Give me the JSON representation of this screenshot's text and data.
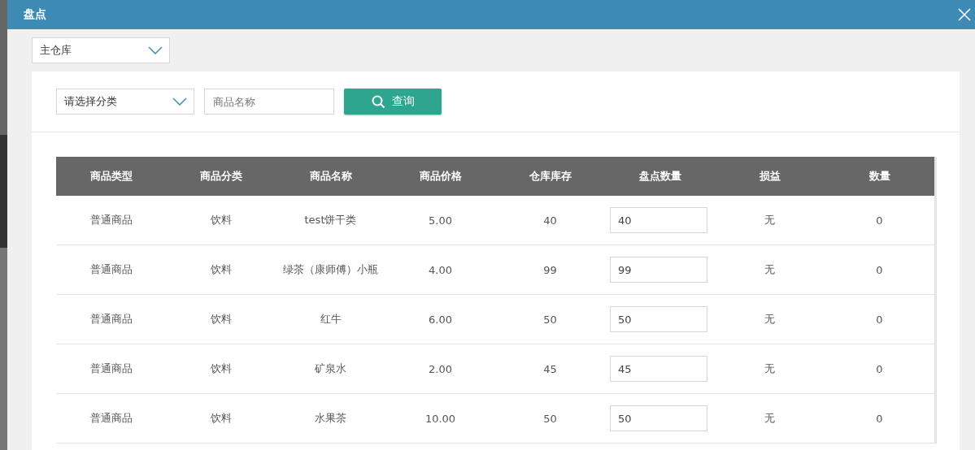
{
  "window": {
    "title": "盘点"
  },
  "warehouse": {
    "value": "主仓库"
  },
  "filters": {
    "category": {
      "value": "请选择分类"
    },
    "name": {
      "placeholder": "商品名称"
    },
    "search_button": "查询"
  },
  "table": {
    "columns": [
      "商品类型",
      "商品分类",
      "商品名称",
      "商品价格",
      "仓库库存",
      "盘点数量",
      "损益",
      "数量"
    ],
    "rows": [
      {
        "type": "普通商品",
        "category": "饮料",
        "name": "test饼干类",
        "price": "5.00",
        "stock": "40",
        "count": "40",
        "profit_loss": "无",
        "quantity": "0"
      },
      {
        "type": "普通商品",
        "category": "饮料",
        "name": "绿茶（康师傅）小瓶",
        "price": "4.00",
        "stock": "99",
        "count": "99",
        "profit_loss": "无",
        "quantity": "0"
      },
      {
        "type": "普通商品",
        "category": "饮料",
        "name": "红牛",
        "price": "6.00",
        "stock": "50",
        "count": "50",
        "profit_loss": "无",
        "quantity": "0"
      },
      {
        "type": "普通商品",
        "category": "饮料",
        "name": "矿泉水",
        "price": "2.00",
        "stock": "45",
        "count": "45",
        "profit_loss": "无",
        "quantity": "0"
      },
      {
        "type": "普通商品",
        "category": "饮料",
        "name": "水果茶",
        "price": "10.00",
        "stock": "50",
        "count": "50",
        "profit_loss": "无",
        "quantity": "0"
      }
    ]
  }
}
